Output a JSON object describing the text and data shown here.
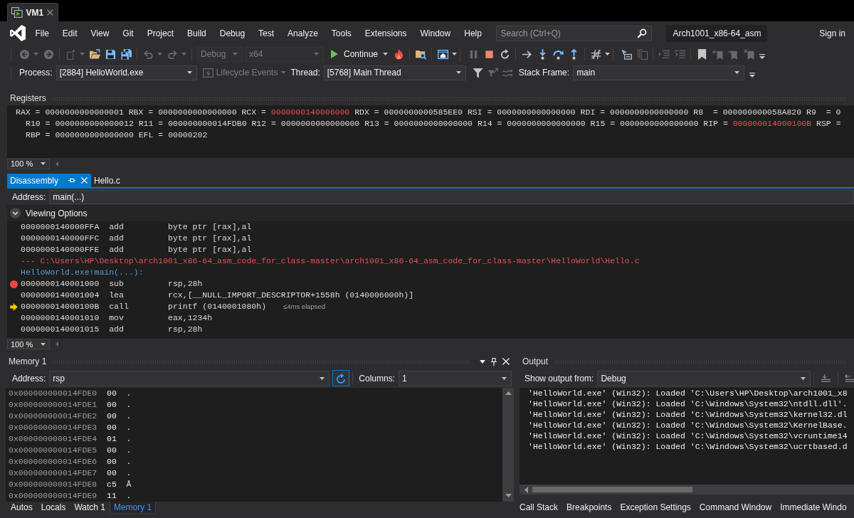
{
  "vm_tab": {
    "title": "VM1"
  },
  "menu": [
    "File",
    "Edit",
    "View",
    "Git",
    "Project",
    "Build",
    "Debug",
    "Test",
    "Analyze",
    "Tools",
    "Extensions",
    "Window",
    "Help"
  ],
  "search": {
    "placeholder": "Search (Ctrl+Q)"
  },
  "solution_name": "Arch1001_x86-64_asm",
  "sign_in": "Sign in",
  "toolbar": {
    "buttons": [
      {
        "disabled": true,
        "dropdown": true
      },
      {
        "disabled": true,
        "dropdown": false
      },
      {
        "disabled": true,
        "dropdown": true
      },
      {
        "disabled": false,
        "dropdown": false
      },
      {
        "disabled": false,
        "dropdown": false
      },
      {
        "disabled": false,
        "dropdown": false
      },
      {
        "disabled": true,
        "dropdown": true
      },
      {
        "disabled": true,
        "dropdown": true
      },
      {
        "disabled": false,
        "dropdown": false
      },
      {
        "disabled": false,
        "dropdown": false
      },
      {
        "disabled": false,
        "dropdown": true
      },
      {
        "disabled": true,
        "dropdown": false
      },
      {
        "disabled": false,
        "dropdown": false
      },
      {
        "disabled": false,
        "dropdown": false
      },
      {
        "disabled": false,
        "dropdown": false
      },
      {
        "disabled": false,
        "dropdown": false
      },
      {
        "disabled": false,
        "dropdown": false
      },
      {
        "disabled": false,
        "dropdown": false
      },
      {
        "disabled": false,
        "dropdown": true
      },
      {
        "disabled": false,
        "dropdown": false
      },
      {
        "disabled": true,
        "dropdown": false
      },
      {
        "disabled": true,
        "dropdown": false
      },
      {
        "disabled": true,
        "dropdown": false
      },
      {
        "disabled": false,
        "dropdown": false
      },
      {
        "disabled": true,
        "dropdown": false
      },
      {
        "disabled": true,
        "dropdown": false
      },
      {
        "disabled": true,
        "dropdown": false
      }
    ],
    "configuration": {
      "value": "Debug",
      "disabled": true
    },
    "platform": {
      "value": "x64",
      "disabled": true
    },
    "continue_button": {
      "label": "Continue"
    }
  },
  "debug_location": {
    "process": {
      "label": "Process:",
      "value": "[2884] HelloWorld.exe"
    },
    "lifecycle_events": {
      "label": "Lifecycle Events",
      "disabled": true
    },
    "thread": {
      "label": "Thread:",
      "value": "[5768] Main Thread"
    },
    "thread_buttons": [
      {
        "disabled": false
      },
      {
        "disabled": true
      },
      {
        "disabled": true
      }
    ],
    "stack_frame": {
      "label": "Stack Frame:",
      "value": "main"
    }
  },
  "registers": {
    "title": "Registers",
    "lines": [
      [
        {
          "label": "RAX =",
          "value": "0000000000000001",
          "changed": false
        },
        {
          "label": "RBX =",
          "value": "0000000000000000",
          "changed": false
        },
        {
          "label": "RCX =",
          "value": "0000000140006000",
          "changed": true
        },
        {
          "label": "RDX =",
          "value": "0000000000585EE0",
          "changed": false
        },
        {
          "label": "RSI =",
          "value": "0000000000000000",
          "changed": false
        },
        {
          "label": "RDI =",
          "value": "0000000000000000",
          "changed": false
        },
        {
          "label": "R8  =",
          "value": "000000000058A820",
          "changed": false
        },
        {
          "label": "R9  =",
          "value": "0",
          "changed": false
        }
      ],
      [
        {
          "label": "R10 =",
          "value": "0000000000000012",
          "changed": false
        },
        {
          "label": "R11 =",
          "value": "000000000014FDB0",
          "changed": false
        },
        {
          "label": "R12 =",
          "value": "0000000000000000",
          "changed": false
        },
        {
          "label": "R13 =",
          "value": "0000000000000000",
          "changed": false
        },
        {
          "label": "R14 =",
          "value": "0000000000000000",
          "changed": false
        },
        {
          "label": "R15 =",
          "value": "0000000000000000",
          "changed": false
        },
        {
          "label": "RIP =",
          "value": "000000014000100B",
          "changed": true
        },
        {
          "label": "RSP ="
        }
      ],
      [
        {
          "label": "RBP =",
          "value": "0000000000000000",
          "changed": false
        },
        {
          "label": "EFL =",
          "value": "00000202",
          "changed": false
        }
      ]
    ],
    "zoom": "100 %"
  },
  "document_tabs": [
    {
      "title": "Disassembly",
      "selected": true
    },
    {
      "title": "Hello.c",
      "selected": false
    }
  ],
  "disassembly": {
    "address_label": "Address:",
    "address": "main(...)",
    "viewing_options": "Viewing Options",
    "lines": [
      {
        "kind": "instruction",
        "address": "0000000140000FFA",
        "mnemonic": "add",
        "operands": "byte ptr [rax],al",
        "breakpoint": false,
        "current": false
      },
      {
        "kind": "instruction",
        "address": "0000000140000FFC",
        "mnemonic": "add",
        "operands": "byte ptr [rax],al",
        "breakpoint": false,
        "current": false
      },
      {
        "kind": "instruction",
        "address": "0000000140000FFE",
        "mnemonic": "add",
        "operands": "byte ptr [rax],al",
        "breakpoint": false,
        "current": false
      },
      {
        "kind": "source",
        "text": "--- C:\\Users\\HP\\Desktop\\arch1001_x86-64_asm_code_for_class-master\\arch1001_x86-64_asm_code_for_class-master\\HelloWorld\\Hello.c"
      },
      {
        "kind": "symbol",
        "text": "HelloWorld.exe!main(...):"
      },
      {
        "kind": "instruction",
        "address": "0000000140001000",
        "mnemonic": "sub",
        "operands": "rsp,28h",
        "breakpoint": true,
        "current": false
      },
      {
        "kind": "instruction",
        "address": "0000000140001004",
        "mnemonic": "lea",
        "operands": "rcx,[__NULL_IMPORT_DESCRIPTOR+1558h (0140006000h)]",
        "breakpoint": false,
        "current": false
      },
      {
        "kind": "instruction",
        "address": "000000014000100B",
        "mnemonic": "call",
        "operands": "printf (0140001080h)",
        "note": "≤4ms elapsed",
        "breakpoint": false,
        "current": true
      },
      {
        "kind": "instruction",
        "address": "0000000140001010",
        "mnemonic": "mov",
        "operands": "eax,1234h",
        "breakpoint": false,
        "current": false
      },
      {
        "kind": "instruction",
        "address": "0000000140001015",
        "mnemonic": "add",
        "operands": "rsp,28h",
        "breakpoint": false,
        "current": false
      }
    ],
    "zoom": "100 %"
  },
  "memory": {
    "title": "Memory 1",
    "address_label": "Address:",
    "address": "rsp",
    "columns_label": "Columns:",
    "columns": "1",
    "rows": [
      {
        "address": "0x000000000014FDE0",
        "byte": "00",
        "char": "."
      },
      {
        "address": "0x000000000014FDE1",
        "byte": "00",
        "char": "."
      },
      {
        "address": "0x000000000014FDE2",
        "byte": "00",
        "char": "."
      },
      {
        "address": "0x000000000014FDE3",
        "byte": "00",
        "char": "."
      },
      {
        "address": "0x000000000014FDE4",
        "byte": "01",
        "char": "."
      },
      {
        "address": "0x000000000014FDE5",
        "byte": "00",
        "char": "."
      },
      {
        "address": "0x000000000014FDE6",
        "byte": "00",
        "char": "."
      },
      {
        "address": "0x000000000014FDE7",
        "byte": "00",
        "char": "."
      },
      {
        "address": "0x000000000014FDE8",
        "byte": "c5",
        "char": "Å"
      },
      {
        "address": "0x000000000014FDE9",
        "byte": "11",
        "char": "."
      }
    ]
  },
  "output": {
    "title": "Output",
    "source_label": "Show output from:",
    "source": "Debug",
    "lines": [
      "'HelloWorld.exe' (Win32): Loaded 'C:\\Users\\HP\\Desktop\\arch1001_x8",
      "'HelloWorld.exe' (Win32): Loaded 'C:\\Windows\\System32\\ntdll.dll'.",
      "'HelloWorld.exe' (Win32): Loaded 'C:\\Windows\\System32\\kernel32.dl",
      "'HelloWorld.exe' (Win32): Loaded 'C:\\Windows\\System32\\KernelBase.",
      "'HelloWorld.exe' (Win32): Loaded 'C:\\Windows\\System32\\vcruntime14",
      "'HelloWorld.exe' (Win32): Loaded 'C:\\Windows\\System32\\ucrtbased.d"
    ]
  },
  "tool_tabs_left": [
    {
      "label": "Autos",
      "selected": false
    },
    {
      "label": "Locals",
      "selected": false
    },
    {
      "label": "Watch 1",
      "selected": false
    },
    {
      "label": "Memory 1",
      "selected": true
    }
  ],
  "tool_tabs_right": [
    {
      "label": "Call Stack",
      "selected": false
    },
    {
      "label": "Breakpoints",
      "selected": false
    },
    {
      "label": "Exception Settings",
      "selected": false
    },
    {
      "label": "Command Window",
      "selected": false
    },
    {
      "label": "Immediate Windo",
      "selected": false
    }
  ]
}
